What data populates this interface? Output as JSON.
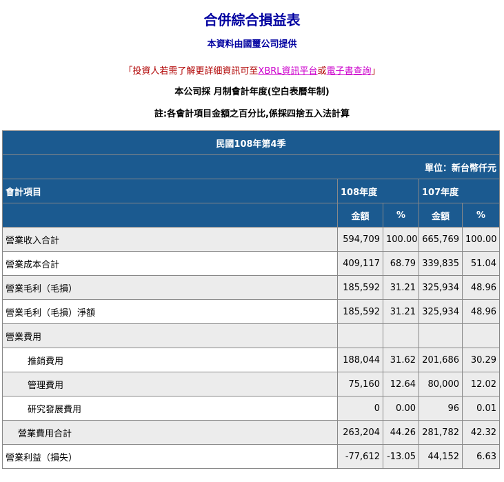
{
  "header": {
    "title": "合併綜合損益表",
    "provider": "本資料由國璽公司提供",
    "notice_prefix": "「投資人若需了解更詳細資訊可至",
    "notice_link1": "XBRL資訊平台",
    "notice_or": "或",
    "notice_link2": "電子書查詢",
    "notice_suffix": "」",
    "calendar": "本公司採 月制會計年度(空白表曆年制)",
    "note": "註:各會計項目金額之百分比,係採四捨五入法計算"
  },
  "table": {
    "period": "民國108年第4季",
    "unit": "單位：新台幣仟元",
    "col_item": "會計項目",
    "col_year1": "108年度",
    "col_year2": "107年度",
    "col_amount1": "金額",
    "col_pct1": "%",
    "col_amount2": "金額",
    "col_pct2": "%",
    "rows": [
      {
        "label": "營業收入合計",
        "a1": "594,709",
        "p1": "100.00",
        "a2": "665,769",
        "p2": "100.00"
      },
      {
        "label": "營業成本合計",
        "a1": "409,117",
        "p1": "68.79",
        "a2": "339,835",
        "p2": "51.04"
      },
      {
        "label": "營業毛利（毛損）",
        "a1": "185,592",
        "p1": "31.21",
        "a2": "325,934",
        "p2": "48.96"
      },
      {
        "label": "營業毛利（毛損）淨額",
        "a1": "185,592",
        "p1": "31.21",
        "a2": "325,934",
        "p2": "48.96"
      },
      {
        "label": "營業費用",
        "a1": "",
        "p1": "",
        "a2": "",
        "p2": ""
      },
      {
        "label": "推銷費用",
        "a1": "188,044",
        "p1": "31.62",
        "a2": "201,686",
        "p2": "30.29"
      },
      {
        "label": "管理費用",
        "a1": "75,160",
        "p1": "12.64",
        "a2": "80,000",
        "p2": "12.02"
      },
      {
        "label": "研究發展費用",
        "a1": "0",
        "p1": "0.00",
        "a2": "96",
        "p2": "0.01"
      },
      {
        "label": "營業費用合計",
        "a1": "263,204",
        "p1": "44.26",
        "a2": "281,782",
        "p2": "42.32"
      },
      {
        "label": "營業利益（損失）",
        "a1": "-77,612",
        "p1": "-13.05",
        "a2": "44,152",
        "p2": "6.63"
      }
    ]
  }
}
